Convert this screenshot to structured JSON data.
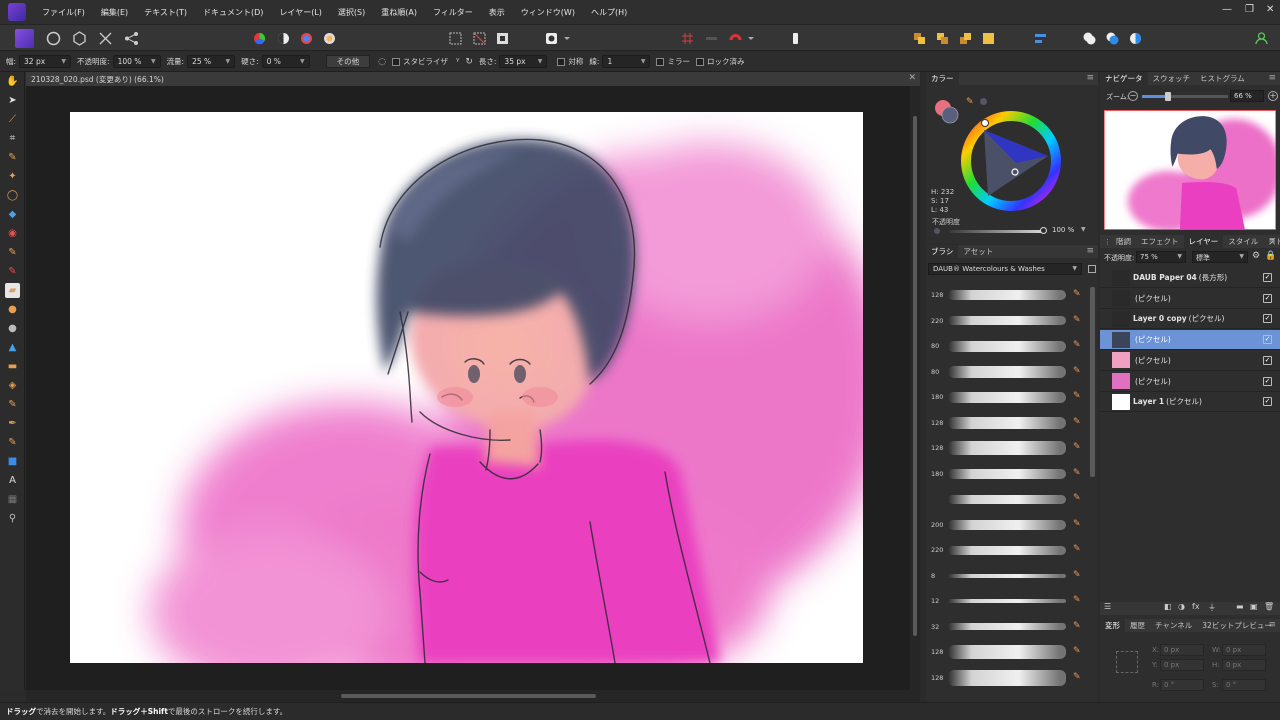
{
  "menubar": {
    "items": [
      "ファイル(F)",
      "編集(E)",
      "テキスト(T)",
      "ドキュメント(D)",
      "レイヤー(L)",
      "選択(S)",
      "重ね順(A)",
      "フィルター",
      "表示",
      "ウィンドウ(W)",
      "ヘルプ(H)"
    ],
    "window_controls": [
      "—",
      "❐",
      "✕"
    ]
  },
  "context_bar": {
    "width_label": "幅:",
    "width_value": "32 px",
    "opacity_label": "不透明度:",
    "opacity_value": "100 %",
    "flow_label": "流量:",
    "flow_value": "25 %",
    "hardness_label": "硬さ:",
    "hardness_value": "0 %",
    "more_button": "その他",
    "stabilizer_label": "スタビライザ",
    "length_label": "長さ:",
    "length_value": "35 px",
    "symmetry_label": "対称",
    "lines_label": "線:",
    "lines_value": "1",
    "mirror_label": "ミラー",
    "lock_label": "ロック済み"
  },
  "document": {
    "tab_title": "210328_020.psd (変更あり) (66.1%)"
  },
  "color_panel": {
    "tab": "カラー",
    "h": "H: 232",
    "s": "S: 17",
    "l": "L: 43",
    "opacity_label": "不透明度",
    "opacity_value": "100 %",
    "primary_color": "#e8707e",
    "secondary_color": "#5a5f80"
  },
  "brush_panel": {
    "tabs": [
      "ブラシ",
      "アセット"
    ],
    "category": "DAUB® Watercolours & Washes",
    "brush_sizes": [
      "128",
      "220",
      "80",
      "80",
      "180",
      "128",
      "128",
      "180",
      "",
      "200",
      "220",
      "8",
      "12",
      "32",
      "128",
      "128"
    ]
  },
  "navigator_panel": {
    "tabs": [
      "ナビゲータ",
      "スウォッチ",
      "ヒストグラム"
    ],
    "zoom_label": "ズーム:",
    "zoom_value": "66 %",
    "zoom_level": 0.3
  },
  "layers_panel": {
    "tabs": [
      "階調",
      "エフェクト",
      "レイヤー",
      "スタイル",
      "ストック"
    ],
    "opacity_label": "不透明度:",
    "opacity_value": "75 %",
    "blend_mode": "標準",
    "layers": [
      {
        "name": "DAUB Paper 04",
        "type": "(長方形)",
        "selected": false
      },
      {
        "name": "",
        "type": "(ピクセル)",
        "selected": false
      },
      {
        "name": "Layer 0 copy",
        "type": "(ピクセル)",
        "selected": false
      },
      {
        "name": "",
        "type": "(ピクセル)",
        "selected": true
      },
      {
        "name": "",
        "type": "(ピクセル)",
        "selected": false
      },
      {
        "name": "",
        "type": "(ピクセル)",
        "selected": false
      },
      {
        "name": "Layer 1",
        "type": "(ピクセル)",
        "selected": false
      }
    ]
  },
  "transform_panel": {
    "tabs": [
      "変形",
      "履歴",
      "チャンネル",
      "32ビットプレビュー"
    ],
    "x_label": "X:",
    "x_value": "0 px",
    "y_label": "Y:",
    "y_value": "0 px",
    "w_label": "W:",
    "w_value": "0 px",
    "h_label": "H:",
    "h_value": "0 px",
    "r_label": "R:",
    "r_value": "0 °",
    "s_label": "S:",
    "s_value": "0 °"
  },
  "statusbar": {
    "bold1": "ドラッグ",
    "text1": "で消去を開始します。",
    "bold2": "ドラッグ＋Shift",
    "text2": "で最後のストロークを続行します。"
  }
}
